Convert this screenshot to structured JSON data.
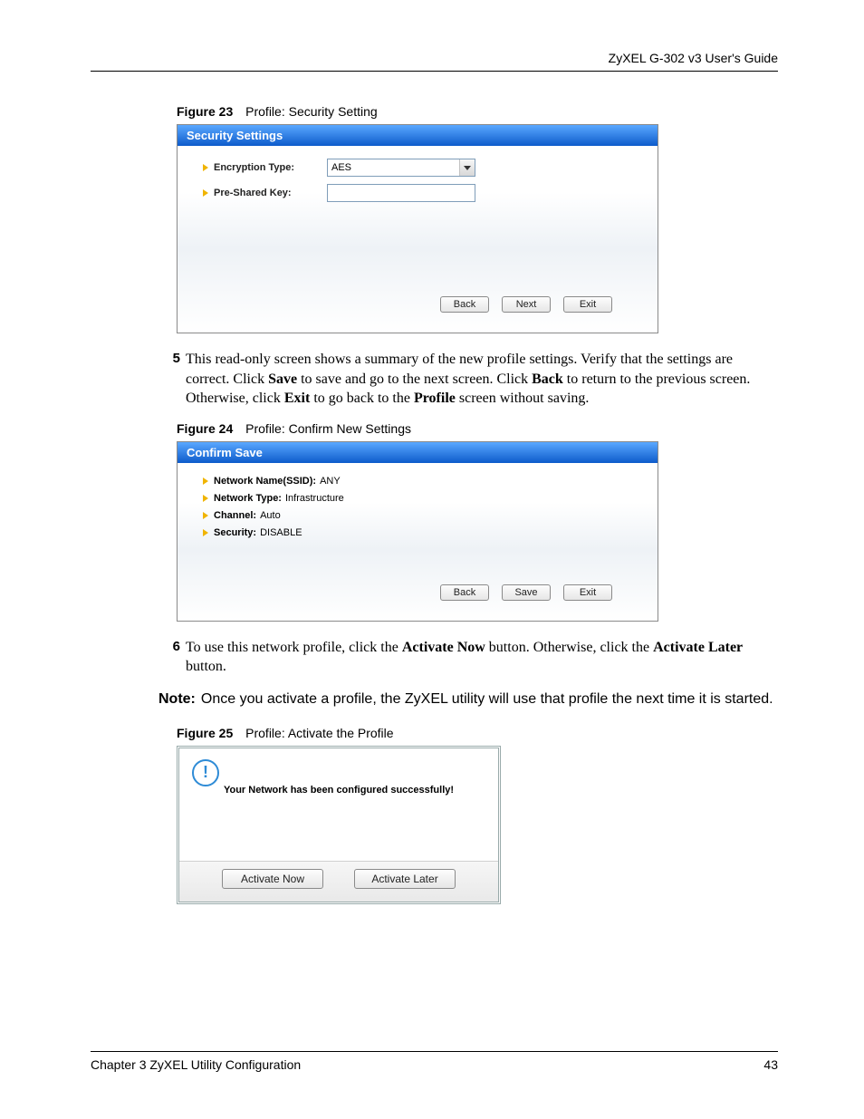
{
  "header": {
    "running": "ZyXEL G-302 v3 User's Guide"
  },
  "figures": {
    "f23": {
      "label": "Figure 23",
      "caption": "Profile: Security Setting"
    },
    "f24": {
      "label": "Figure 24",
      "caption": "Profile: Confirm New Settings"
    },
    "f25": {
      "label": "Figure 25",
      "caption": "Profile: Activate the Profile"
    }
  },
  "dlg1": {
    "title": "Security Settings",
    "encryption_label": "Encryption Type:",
    "encryption_value": "AES",
    "psk_label": "Pre-Shared Key:",
    "buttons": {
      "back": "Back",
      "next": "Next",
      "exit": "Exit"
    }
  },
  "step5": {
    "num": "5",
    "pre": "This read-only screen shows a summary of the new profile settings. Verify that the settings are correct. Click ",
    "b1": "Save",
    "mid1": " to save and go to the next screen. Click ",
    "b2": "Back",
    "mid2": " to return to the previous screen. Otherwise, click ",
    "b3": "Exit",
    "mid3": " to go back to the ",
    "b4": "Profile",
    "post": " screen without saving."
  },
  "dlg2": {
    "title": "Confirm Save",
    "rows": {
      "ssid_label": "Network Name(SSID):",
      "ssid_val": "ANY",
      "type_label": "Network Type:",
      "type_val": "Infrastructure",
      "chan_label": "Channel:",
      "chan_val": "Auto",
      "sec_label": "Security:",
      "sec_val": "DISABLE"
    },
    "buttons": {
      "back": "Back",
      "save": "Save",
      "exit": "Exit"
    }
  },
  "step6": {
    "num": "6",
    "pre": "To use this network profile, click the ",
    "b1": "Activate Now",
    "mid1": " button. Otherwise, click the ",
    "b2": "Activate Later",
    "post": " button."
  },
  "note": {
    "label": "Note:",
    "text": "Once you activate a profile, the ZyXEL utility will use that profile the next time it is started."
  },
  "dlg3": {
    "msg": "Your Network has been configured successfully!",
    "buttons": {
      "now": "Activate Now",
      "later": "Activate Later"
    }
  },
  "footer": {
    "chapter": "Chapter 3 ZyXEL Utility Configuration",
    "page": "43"
  }
}
